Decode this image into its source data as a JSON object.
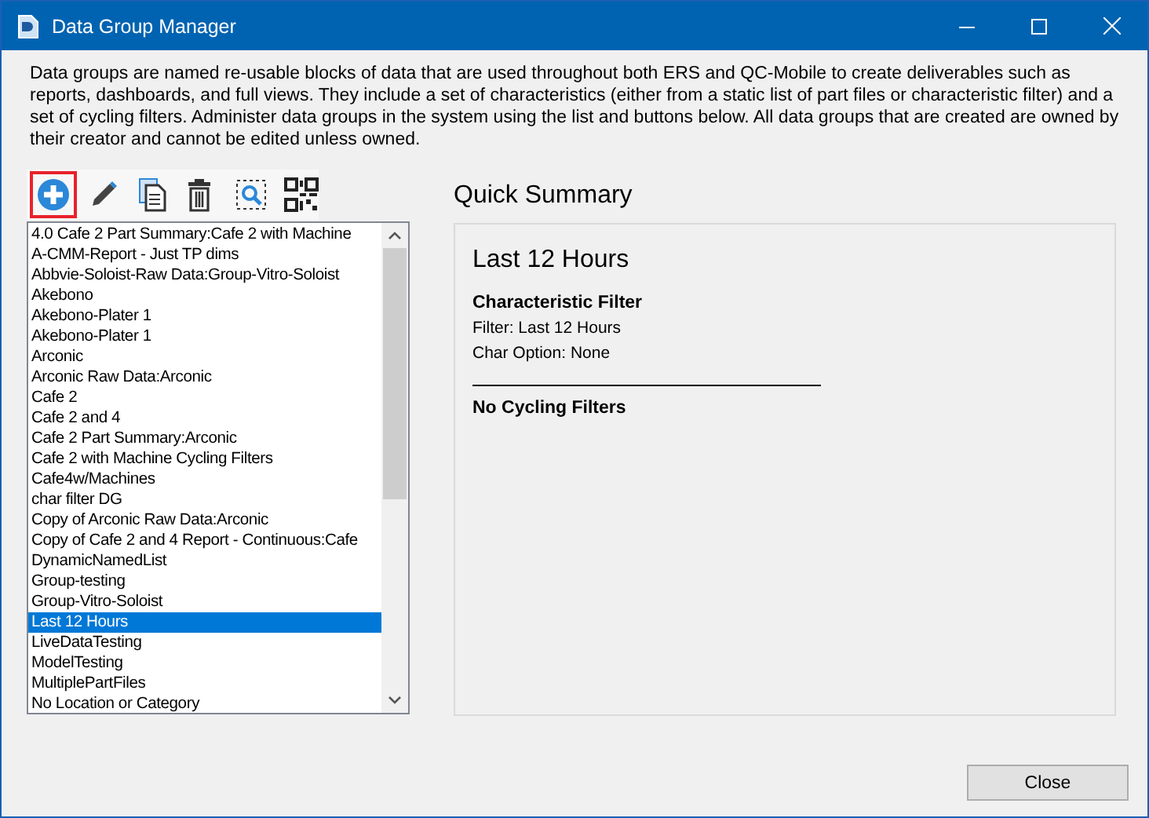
{
  "window": {
    "title": "Data Group Manager"
  },
  "description": "Data groups are named re-usable blocks of data that are used throughout both ERS and QC-Mobile to create deliverables such as reports, dashboards, and full views. They include a set of characteristics (either from a static list of part files or characteristic filter) and a set of cycling filters. Administer data groups in the system using the list and buttons below. All data groups that are created are owned by their creator and cannot be edited unless owned.",
  "toolbar": [
    {
      "kind": "add",
      "highlighted": true
    },
    {
      "kind": "edit",
      "highlighted": false
    },
    {
      "kind": "copy",
      "highlighted": false
    },
    {
      "kind": "delete",
      "highlighted": false
    },
    {
      "kind": "preview",
      "highlighted": false
    },
    {
      "kind": "qr",
      "highlighted": false
    }
  ],
  "list": {
    "items": [
      {
        "label": "4.0 Cafe 2 Part Summary:Cafe 2 with Machine",
        "selected": false
      },
      {
        "label": "A-CMM-Report - Just TP dims",
        "selected": false
      },
      {
        "label": "Abbvie-Soloist-Raw Data:Group-Vitro-Soloist",
        "selected": false
      },
      {
        "label": "Akebono",
        "selected": false
      },
      {
        "label": "Akebono-Plater 1",
        "selected": false
      },
      {
        "label": "Akebono-Plater 1",
        "selected": false
      },
      {
        "label": "Arconic",
        "selected": false
      },
      {
        "label": "Arconic Raw Data:Arconic",
        "selected": false
      },
      {
        "label": "Cafe 2",
        "selected": false
      },
      {
        "label": "Cafe 2 and 4",
        "selected": false
      },
      {
        "label": "Cafe 2 Part Summary:Arconic",
        "selected": false
      },
      {
        "label": "Cafe 2 with Machine Cycling Filters",
        "selected": false
      },
      {
        "label": "Cafe4w/Machines",
        "selected": false
      },
      {
        "label": "char filter DG",
        "selected": false
      },
      {
        "label": "Copy of Arconic Raw Data:Arconic",
        "selected": false
      },
      {
        "label": "Copy of Cafe 2 and 4 Report - Continuous:Cafe",
        "selected": false
      },
      {
        "label": "DynamicNamedList",
        "selected": false
      },
      {
        "label": "Group-testing",
        "selected": false
      },
      {
        "label": "Group-Vitro-Soloist",
        "selected": false
      },
      {
        "label": "Last 12 Hours",
        "selected": true
      },
      {
        "label": "LiveDataTesting",
        "selected": false
      },
      {
        "label": "ModelTesting",
        "selected": false
      },
      {
        "label": "MultiplePartFiles",
        "selected": false
      },
      {
        "label": "No Location or Category",
        "selected": false
      }
    ]
  },
  "summary": {
    "heading": "Quick Summary",
    "title": "Last 12 Hours",
    "sections": [
      {
        "kind": "heading",
        "text": "Characteristic Filter"
      },
      {
        "kind": "line",
        "text": "Filter: Last 12 Hours"
      },
      {
        "kind": "line",
        "text": "Char Option: None"
      },
      {
        "kind": "rule"
      },
      {
        "kind": "heading",
        "text": "No Cycling Filters"
      }
    ]
  },
  "buttons": [
    "Close"
  ]
}
